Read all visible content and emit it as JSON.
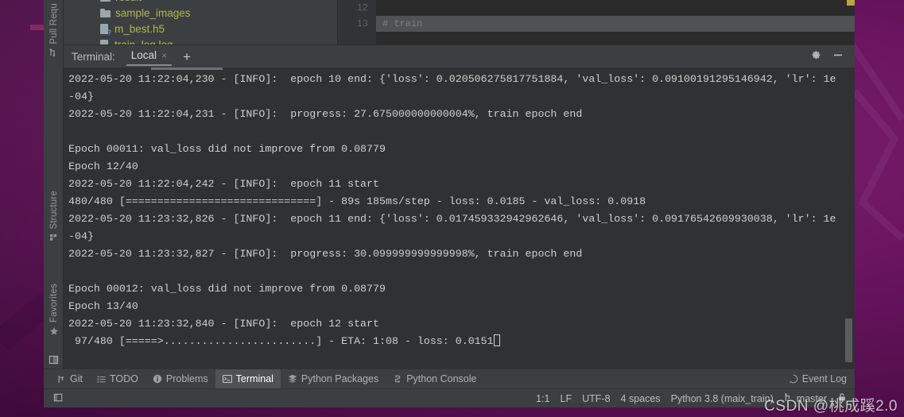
{
  "desktop": {
    "watermark": "CSDN @桃成蹊2.0"
  },
  "left_stripe": {
    "tabs": [
      {
        "label": "Pull Requ",
        "icon": "pull-request-icon"
      },
      {
        "label": "Structure",
        "icon": "structure-icon"
      },
      {
        "label": "Favorites",
        "icon": "star-icon"
      }
    ],
    "bottom_icon": "tool-window-icon"
  },
  "project_tree": {
    "items": [
      {
        "label": "result",
        "icon": "folder-icon",
        "partial": true
      },
      {
        "label": "sample_images",
        "icon": "folder-icon"
      },
      {
        "label": "m_best.h5",
        "icon": "file-unknown-icon"
      },
      {
        "label": "train_log.log",
        "icon": "file-icon",
        "partial": true
      }
    ]
  },
  "editor": {
    "line_numbers": [
      "12",
      "13"
    ],
    "visible_code": "# train"
  },
  "terminal": {
    "title": "Terminal:",
    "tab_label": "Local",
    "tab_close": "×",
    "add_tab": "+",
    "settings_icon": "gear-icon",
    "minimize_icon": "minimize-icon",
    "lines": [
      "2022-05-20 11:22:04,230 - [INFO]:  epoch 10 end: {'loss': 0.020506275817751884, 'val_loss': 0.09100191295146942, 'lr': 1e",
      "-04}",
      "2022-05-20 11:22:04,231 - [INFO]:  progress: 27.675000000000004%, train epoch end",
      "",
      "Epoch 00011: val_loss did not improve from 0.08779",
      "Epoch 12/40",
      "2022-05-20 11:22:04,242 - [INFO]:  epoch 11 start",
      "480/480 [==============================] - 89s 185ms/step - loss: 0.0185 - val_loss: 0.0918",
      "2022-05-20 11:23:32,826 - [INFO]:  epoch 11 end: {'loss': 0.017459332942962646, 'val_loss': 0.09176542609930038, 'lr': 1e",
      "-04}",
      "2022-05-20 11:23:32,827 - [INFO]:  progress: 30.099999999999998%, train epoch end",
      "",
      "Epoch 00012: val_loss did not improve from 0.08779",
      "Epoch 13/40",
      "2022-05-20 11:23:32,840 - [INFO]:  epoch 12 start",
      " 97/480 [=====>........................] - ETA: 1:08 - loss: 0.0151"
    ]
  },
  "bottom_bar": {
    "buttons": [
      {
        "label": "Git",
        "icon": "git-branch-icon",
        "active": false
      },
      {
        "label": "TODO",
        "icon": "todo-list-icon",
        "active": false
      },
      {
        "label": "Problems",
        "icon": "problems-icon",
        "active": false
      },
      {
        "label": "Terminal",
        "icon": "terminal-icon",
        "active": true
      },
      {
        "label": "Python Packages",
        "icon": "packages-icon",
        "active": false
      },
      {
        "label": "Python Console",
        "icon": "python-console-icon",
        "active": false
      }
    ],
    "event_log": {
      "label": "Event Log",
      "icon": "event-log-icon"
    }
  },
  "status_bar": {
    "caret_position": "1:1",
    "line_separator": "LF",
    "encoding": "UTF-8",
    "indent": "4 spaces",
    "interpreter": "Python 3.8 (maix_train)",
    "branch": "master",
    "branch_icon": "git-branch-icon",
    "lock_icon": "lock-icon"
  },
  "colors": {
    "panel_bg": "#3c3f41",
    "terminal_bg": "#2f3132",
    "editor_bg": "#2b2b2b",
    "text": "#cfcfcf",
    "tree_text": "#b5b54a",
    "accent": "#4e5254",
    "desktop": "#6b1560"
  }
}
